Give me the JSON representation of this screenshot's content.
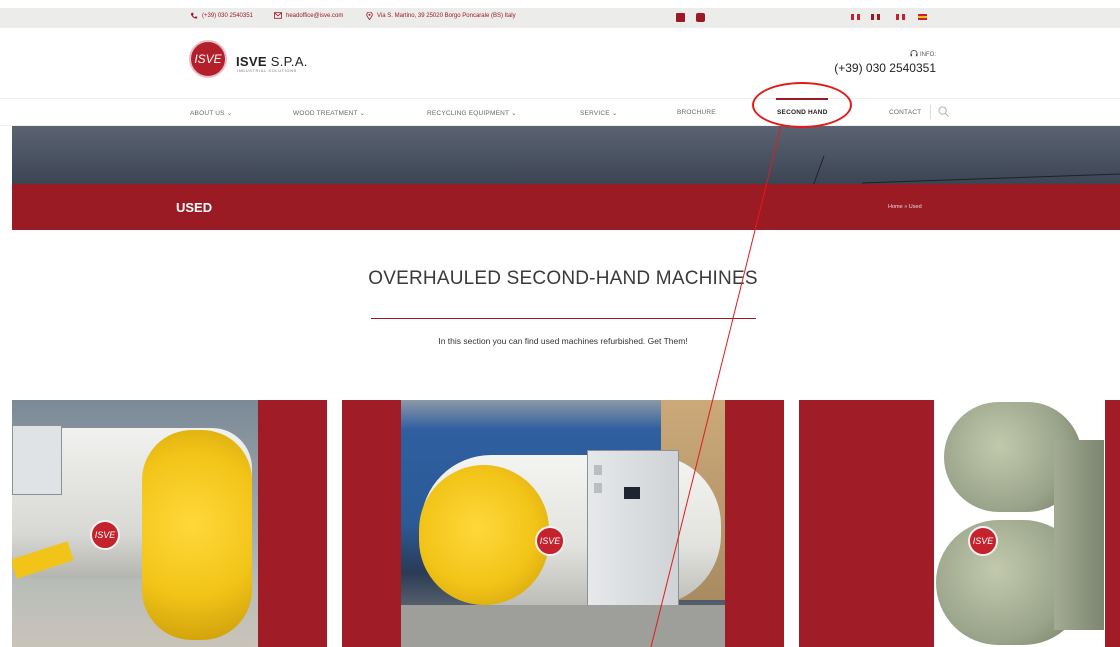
{
  "topbar": {
    "phone": "(+39) 030 2540351",
    "email": "headoffice@isve.com",
    "address": "Via S. Martino, 39 25020 Borgo Poncarale (BS) Italy",
    "social": [
      "linkedin",
      "youtube"
    ],
    "languages": [
      "it",
      "en",
      "fr",
      "es"
    ]
  },
  "header": {
    "logo_mark": "ISVE",
    "logo_name_bold": "ISVE",
    "logo_name_rest": " S.P.A.",
    "logo_sub": "INDUSTRIAL SOLUTIONS",
    "info_label": "INFO:",
    "info_phone": "(+39) 030 2540351"
  },
  "nav": {
    "items": [
      {
        "label": "ABOUT US",
        "has_dropdown": true
      },
      {
        "label": "WOOD TREATMENT",
        "has_dropdown": true
      },
      {
        "label": "RECYCLING EQUIPMENT",
        "has_dropdown": true
      },
      {
        "label": "SERVICE",
        "has_dropdown": true
      },
      {
        "label": "BROCHURE",
        "has_dropdown": false
      },
      {
        "label": "SECOND HAND",
        "has_dropdown": false,
        "active": true
      },
      {
        "label": "CONTACT",
        "has_dropdown": false
      }
    ],
    "dropdown_glyph": "⌄"
  },
  "page": {
    "title": "USED",
    "breadcrumb_home": "Home",
    "breadcrumb_sep": "»",
    "breadcrumb_current": "Used"
  },
  "section": {
    "title": "OVERHAULED SECOND-HAND MACHINES",
    "subtitle": "In this section you can find used machines refurbished. Get Them!"
  },
  "cards": [
    {
      "badge": "ISVE"
    },
    {
      "badge": "ISVE"
    },
    {
      "badge": "ISVE"
    }
  ],
  "colors": {
    "brand_red": "#9b1b24",
    "annotation_red": "#e11b1b",
    "tank_yellow": "#f2c418"
  }
}
